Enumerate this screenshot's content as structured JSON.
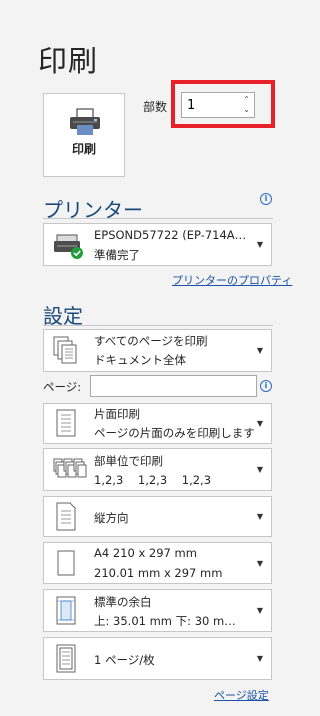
{
  "title": "印刷",
  "print_button_label": "印刷",
  "copies": {
    "label": "部数",
    "value": "1"
  },
  "printer": {
    "heading": "プリンター",
    "name": "EPSOND57722 (EP-714A…",
    "status": "準備完了",
    "properties_link": "プリンターのプロパティ"
  },
  "settings": {
    "heading": "設定",
    "pages_label": "ページ:",
    "pages_value": "",
    "items": [
      {
        "line1": "すべてのページを印刷",
        "line2": "ドキュメント全体",
        "icon": "document-pages-icon"
      },
      {
        "line1": "片面印刷",
        "line2": "ページの片面のみを印刷します",
        "icon": "one-sided-icon"
      },
      {
        "line1": "部単位で印刷",
        "line2": "1,2,3    1,2,3    1,2,3",
        "icon": "collate-icon"
      },
      {
        "line1": "縦方向",
        "line2": "",
        "icon": "portrait-icon"
      },
      {
        "line1": "A4 210 x 297 mm",
        "line2": "210.01 mm x 297 mm",
        "icon": "paper-size-icon"
      },
      {
        "line1": "標準の余白",
        "line2": "上: 35.01 mm 下: 30 m…",
        "icon": "margins-icon"
      },
      {
        "line1": "1 ページ/枚",
        "line2": "",
        "icon": "pages-per-sheet-icon"
      }
    ],
    "page_setup_link": "ページ設定"
  },
  "colors": {
    "accent": "#17497a",
    "link": "#1a53a4",
    "highlight": "#e8202a",
    "status_ok": "#1f9e3a"
  }
}
